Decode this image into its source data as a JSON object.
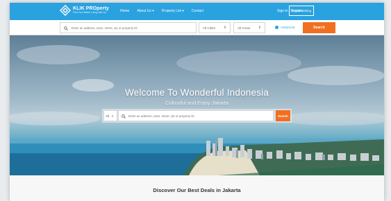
{
  "brand": {
    "name": "KLIK PROperty",
    "tagline": "Find Your Better Living with Us",
    "accent_color": "#2aa2e0",
    "cta_color": "#f26f21"
  },
  "nav": {
    "links": [
      "Home",
      "About Us ▾",
      "Property List ▾",
      "Contact"
    ],
    "signin": "Sign in / Register",
    "create_listing": "Create Listing"
  },
  "search_bar": {
    "placeholder": "Enter an address, town, street, zip or property ID",
    "cities": "All Cities",
    "areas": "All Areas",
    "advanced": "Advanced",
    "button": "Search",
    "icon": "search-icon"
  },
  "hero": {
    "title": "Welcome To Wonderful Indonesia",
    "subtitle": "Colourful and Enjoy Jakarta",
    "select_value": "All",
    "placeholder": "Enter an address, town, street, zip or property ID",
    "button": "Search"
  },
  "deals": {
    "title": "Discover Our Best Deals in Jakarta"
  }
}
